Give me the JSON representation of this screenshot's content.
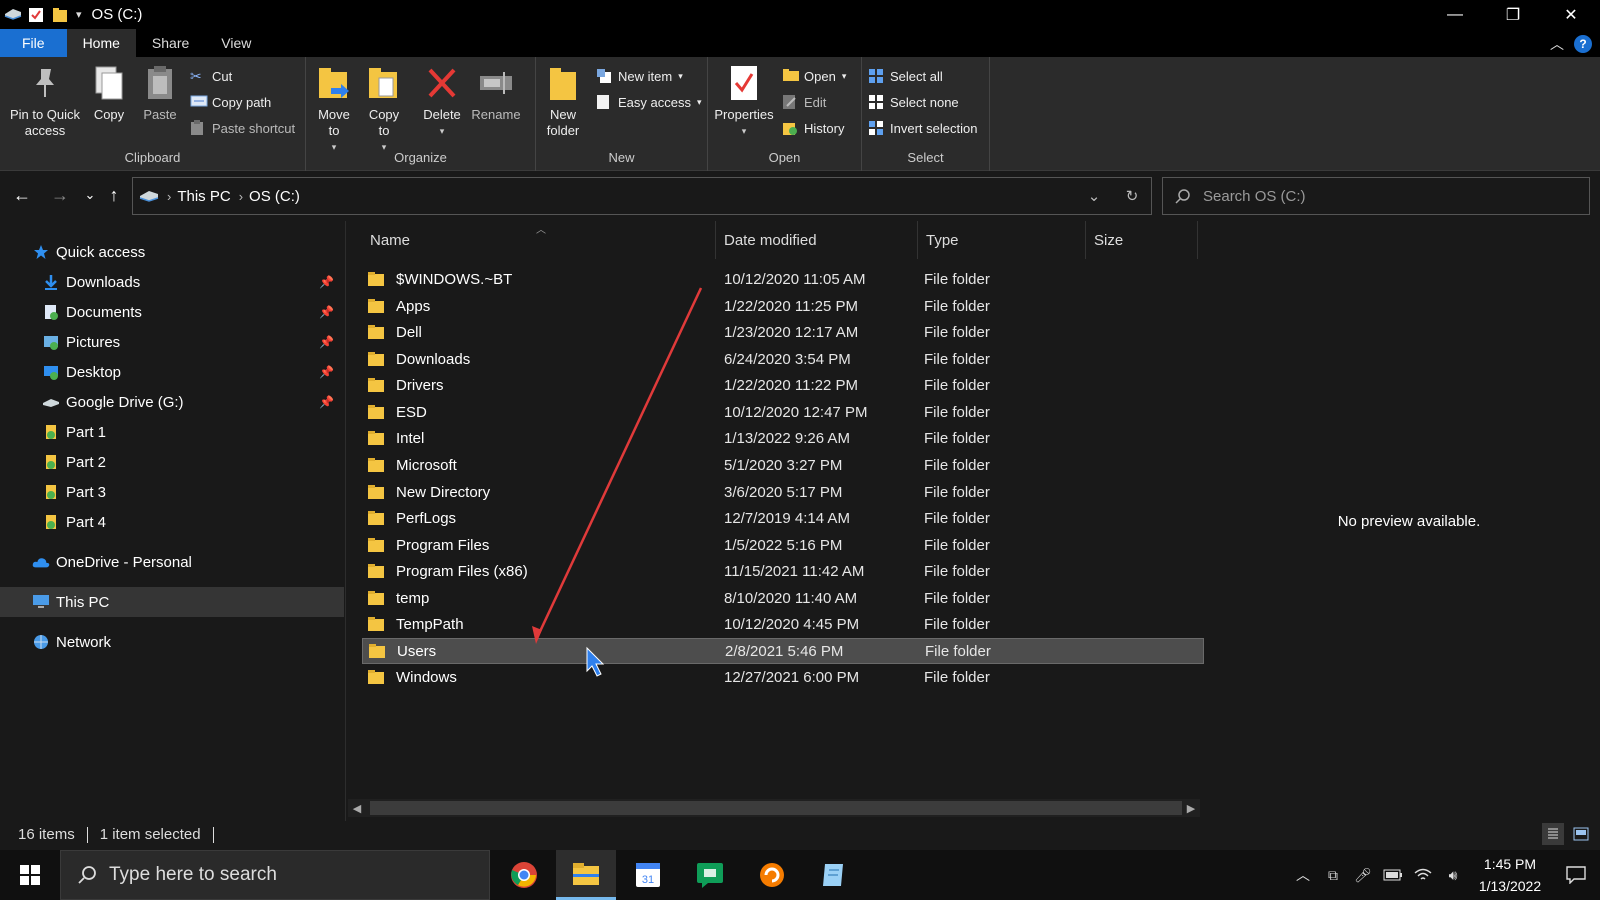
{
  "window": {
    "title": "OS (C:)",
    "controls": {
      "minimize": "—",
      "restore": "❐",
      "close": "✕"
    }
  },
  "ribbon_tabs": [
    "File",
    "Home",
    "Share",
    "View"
  ],
  "ribbon": {
    "clipboard": {
      "label": "Clipboard",
      "pin": "Pin to Quick access",
      "copy": "Copy",
      "paste": "Paste",
      "cut": "Cut",
      "copy_path": "Copy path",
      "paste_shortcut": "Paste shortcut"
    },
    "organize": {
      "label": "Organize",
      "move_to": "Move to",
      "copy_to": "Copy to",
      "delete": "Delete",
      "rename": "Rename"
    },
    "new": {
      "label": "New",
      "new_folder": "New folder",
      "new_item": "New item",
      "easy_access": "Easy access"
    },
    "open": {
      "label": "Open",
      "properties": "Properties",
      "open": "Open",
      "edit": "Edit",
      "history": "History"
    },
    "select": {
      "label": "Select",
      "select_all": "Select all",
      "select_none": "Select none",
      "invert_selection": "Invert selection"
    }
  },
  "address": {
    "crumbs": [
      "This PC",
      "OS (C:)"
    ],
    "search_placeholder": "Search OS (C:)"
  },
  "sidebar": {
    "items": [
      {
        "label": "Quick access",
        "icon": "star-icon",
        "pinned": false
      },
      {
        "label": "Downloads",
        "icon": "download-icon",
        "pinned": true
      },
      {
        "label": "Documents",
        "icon": "documents-icon",
        "pinned": true
      },
      {
        "label": "Pictures",
        "icon": "pictures-icon",
        "pinned": true
      },
      {
        "label": "Desktop",
        "icon": "desktop-icon",
        "pinned": true
      },
      {
        "label": "Google Drive (G:)",
        "icon": "drive-icon",
        "pinned": true
      },
      {
        "label": "Part 1",
        "icon": "part-icon",
        "pinned": false
      },
      {
        "label": "Part 2",
        "icon": "part-icon",
        "pinned": false
      },
      {
        "label": "Part 3",
        "icon": "part-icon",
        "pinned": false
      },
      {
        "label": "Part 4",
        "icon": "part-icon",
        "pinned": false
      },
      {
        "label": "OneDrive - Personal",
        "icon": "cloud-icon",
        "pinned": false
      },
      {
        "label": "This PC",
        "icon": "pc-icon",
        "pinned": false
      },
      {
        "label": "Network",
        "icon": "network-icon",
        "pinned": false
      }
    ]
  },
  "filelist": {
    "columns": [
      "Name",
      "Date modified",
      "Type",
      "Size"
    ],
    "rows": [
      {
        "name": "$WINDOWS.~BT",
        "date": "10/12/2020 11:05 AM",
        "type": "File folder"
      },
      {
        "name": "Apps",
        "date": "1/22/2020 11:25 PM",
        "type": "File folder"
      },
      {
        "name": "Dell",
        "date": "1/23/2020 12:17 AM",
        "type": "File folder"
      },
      {
        "name": "Downloads",
        "date": "6/24/2020 3:54 PM",
        "type": "File folder"
      },
      {
        "name": "Drivers",
        "date": "1/22/2020 11:22 PM",
        "type": "File folder"
      },
      {
        "name": "ESD",
        "date": "10/12/2020 12:47 PM",
        "type": "File folder"
      },
      {
        "name": "Intel",
        "date": "1/13/2022 9:26 AM",
        "type": "File folder"
      },
      {
        "name": "Microsoft",
        "date": "5/1/2020 3:27 PM",
        "type": "File folder"
      },
      {
        "name": "New Directory",
        "date": "3/6/2020 5:17 PM",
        "type": "File folder"
      },
      {
        "name": "PerfLogs",
        "date": "12/7/2019 4:14 AM",
        "type": "File folder"
      },
      {
        "name": "Program Files",
        "date": "1/5/2022 5:16 PM",
        "type": "File folder"
      },
      {
        "name": "Program Files (x86)",
        "date": "11/15/2021 11:42 AM",
        "type": "File folder"
      },
      {
        "name": "temp",
        "date": "8/10/2020 11:40 AM",
        "type": "File folder"
      },
      {
        "name": "TempPath",
        "date": "10/12/2020 4:45 PM",
        "type": "File folder"
      },
      {
        "name": "Users",
        "date": "2/8/2021 5:46 PM",
        "type": "File folder"
      },
      {
        "name": "Windows",
        "date": "12/27/2021 6:00 PM",
        "type": "File folder"
      }
    ]
  },
  "preview": {
    "text": "No preview available."
  },
  "status": {
    "count": "16 items",
    "selected": "1 item selected"
  },
  "taskbar": {
    "search_placeholder": "Type here to search",
    "time": "1:45 PM",
    "date": "1/13/2022"
  },
  "colors": {
    "accent": "#1a6fd1",
    "folder": "#f4c542",
    "annotation_arrow": "#e03a3a"
  }
}
